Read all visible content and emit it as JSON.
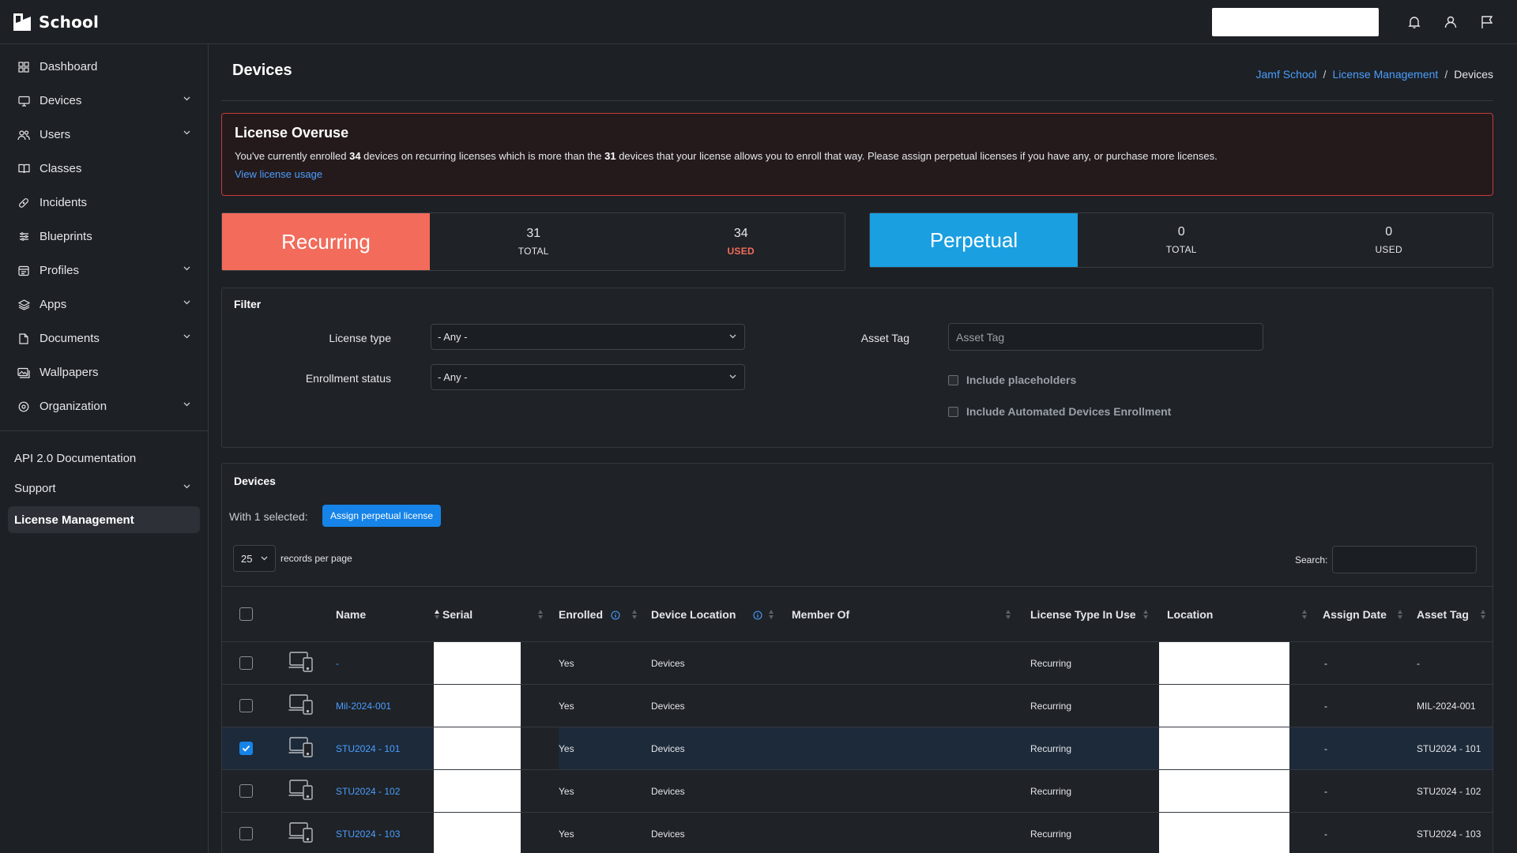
{
  "app": {
    "name": "School"
  },
  "sidebar": {
    "items": [
      {
        "label": "Dashboard",
        "icon": "dashboard-icon",
        "expandable": false
      },
      {
        "label": "Devices",
        "icon": "monitor-icon",
        "expandable": true
      },
      {
        "label": "Users",
        "icon": "users-icon",
        "expandable": true
      },
      {
        "label": "Classes",
        "icon": "book-icon",
        "expandable": false
      },
      {
        "label": "Incidents",
        "icon": "bandage-icon",
        "expandable": false
      },
      {
        "label": "Blueprints",
        "icon": "sliders-icon",
        "expandable": false
      },
      {
        "label": "Profiles",
        "icon": "profiles-icon",
        "expandable": true
      },
      {
        "label": "Apps",
        "icon": "layers-icon",
        "expandable": true
      },
      {
        "label": "Documents",
        "icon": "document-icon",
        "expandable": true
      },
      {
        "label": "Wallpapers",
        "icon": "image-icon",
        "expandable": false
      },
      {
        "label": "Organization",
        "icon": "organization-icon",
        "expandable": true
      }
    ],
    "api_docs": "API 2.0 Documentation",
    "support": "Support",
    "license_mgmt": "License Management"
  },
  "page": {
    "title": "Devices",
    "breadcrumb": [
      "Jamf School",
      "License Management",
      "Devices"
    ]
  },
  "alert": {
    "title": "License Overuse",
    "msg_1": "You've currently enrolled ",
    "enrolled": "34",
    "msg_2": " devices on recurring licenses which is more than the ",
    "allowed": "31",
    "msg_3": " devices that your license allows you to enroll that way. Please assign perpetual licenses if you have any, or purchase more licenses.",
    "link": "View license usage"
  },
  "licenses": {
    "recurring": {
      "label": "Recurring",
      "total": "31",
      "total_label": "TOTAL",
      "used": "34",
      "used_label": "USED",
      "color": "#f26b5b"
    },
    "perpetual": {
      "label": "Perpetual",
      "total": "0",
      "total_label": "TOTAL",
      "used": "0",
      "used_label": "USED",
      "color": "#1a9fe0"
    }
  },
  "filter": {
    "title": "Filter",
    "license_type_label": "License type",
    "license_type_value": "- Any -",
    "enrollment_status_label": "Enrollment status",
    "enrollment_status_value": "- Any -",
    "asset_tag_label": "Asset Tag",
    "asset_tag_placeholder": "Asset Tag",
    "include_placeholders": "Include placeholders",
    "include_ade": "Include Automated Devices Enrollment"
  },
  "devices": {
    "title": "Devices",
    "with_selected": "With 1 selected:",
    "assign_btn": "Assign perpetual license",
    "per_page": "25",
    "per_page_label": "records per page",
    "search_label": "Search:",
    "columns": [
      "Name",
      "Serial",
      "Enrolled",
      "Device Location",
      "Member Of",
      "License Type In Use",
      "Location",
      "Assign Date",
      "Asset Tag"
    ],
    "rows": [
      {
        "name": "-",
        "enrolled": "Yes",
        "device_location": "Devices",
        "license_type": "Recurring",
        "assign_date": "-",
        "asset_tag": "-",
        "selected": false
      },
      {
        "name": "Mil-2024-001",
        "enrolled": "Yes",
        "device_location": "Devices",
        "license_type": "Recurring",
        "assign_date": "-",
        "asset_tag": "MIL-2024-001",
        "selected": false
      },
      {
        "name": "STU2024 - 101",
        "enrolled": "Yes",
        "device_location": "Devices",
        "license_type": "Recurring",
        "assign_date": "-",
        "asset_tag": "STU2024 - 101",
        "selected": true
      },
      {
        "name": "STU2024 - 102",
        "enrolled": "Yes",
        "device_location": "Devices",
        "license_type": "Recurring",
        "assign_date": "-",
        "asset_tag": "STU2024 - 102",
        "selected": false
      },
      {
        "name": "STU2024 - 103",
        "enrolled": "Yes",
        "device_location": "Devices",
        "license_type": "Recurring",
        "assign_date": "-",
        "asset_tag": "STU2024 - 103",
        "selected": false
      }
    ]
  }
}
